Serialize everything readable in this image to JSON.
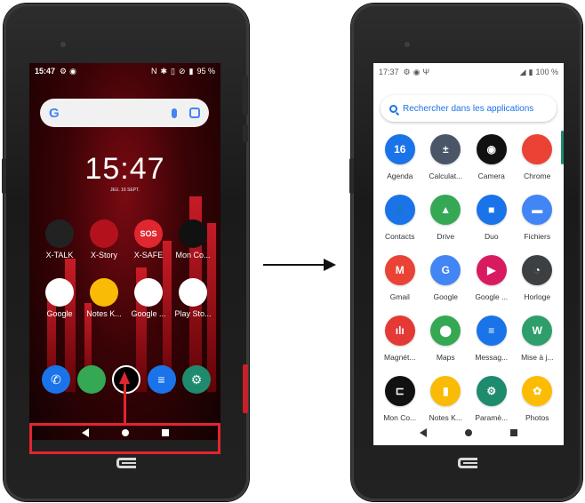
{
  "left_phone": {
    "status": {
      "time": "15:47",
      "battery": "95 %"
    },
    "clock": "15:47",
    "date": "JEU. 16 SEPT.",
    "search_logo": "G",
    "home_apps": [
      {
        "label": "X-TALK",
        "icon": "x-talk-icon",
        "color": "#222222",
        "text": ""
      },
      {
        "label": "X-Story",
        "icon": "x-story-icon",
        "color": "#b3121c",
        "text": ""
      },
      {
        "label": "X-SAFE",
        "icon": "sos-icon",
        "color": "#e0262f",
        "text": "SOS"
      },
      {
        "label": "Mon Co...",
        "icon": "crosscall-icon",
        "color": "#111111",
        "text": ""
      },
      {
        "label": "Google",
        "icon": "google-folder-icon",
        "color": "#ffffff",
        "text": ""
      },
      {
        "label": "Notes K...",
        "icon": "keep-notes-icon",
        "color": "#f9bb06",
        "text": ""
      },
      {
        "label": "Google ...",
        "icon": "play-movies-icon",
        "color": "#ffffff",
        "text": ""
      },
      {
        "label": "Play Sto...",
        "icon": "play-store-icon",
        "color": "#ffffff",
        "text": ""
      }
    ],
    "dock": [
      {
        "icon": "phone-icon",
        "color": "#1a73e8",
        "glyph": "✆"
      },
      {
        "icon": "chrome-icon",
        "color": "#34a853",
        "glyph": ""
      },
      {
        "icon": "swipe-up-icon",
        "color": "#000000",
        "glyph": ""
      },
      {
        "icon": "messages-icon",
        "color": "#1a73e8",
        "glyph": "≡"
      },
      {
        "icon": "settings-icon",
        "color": "#1e8a6e",
        "glyph": "⚙"
      }
    ]
  },
  "right_phone": {
    "status": {
      "time": "17:37",
      "battery": "100 %"
    },
    "search_placeholder": "Rechercher dans les applications",
    "apps": [
      {
        "label": "Agenda",
        "icon": "calendar-icon",
        "color": "#1a73e8",
        "text": "16"
      },
      {
        "label": "Calculat...",
        "icon": "calculator-icon",
        "color": "#4a5568",
        "text": "±"
      },
      {
        "label": "Camera",
        "icon": "camera-icon",
        "color": "#111111",
        "text": "◉"
      },
      {
        "label": "Chrome",
        "icon": "chrome-icon",
        "color": "#ea4335",
        "text": ""
      },
      {
        "label": "Contacts",
        "icon": "contacts-icon",
        "color": "#1a73e8",
        "text": "👤"
      },
      {
        "label": "Drive",
        "icon": "drive-icon",
        "color": "#34a853",
        "text": "▲"
      },
      {
        "label": "Duo",
        "icon": "duo-icon",
        "color": "#1a73e8",
        "text": "■"
      },
      {
        "label": "Fichiers",
        "icon": "files-icon",
        "color": "#4285f4",
        "text": "▬"
      },
      {
        "label": "Gmail",
        "icon": "gmail-icon",
        "color": "#ea4335",
        "text": "M"
      },
      {
        "label": "Google",
        "icon": "google-icon",
        "color": "#4285f4",
        "text": "G"
      },
      {
        "label": "Google ...",
        "icon": "play-movies-icon",
        "color": "#d81b60",
        "text": "▶"
      },
      {
        "label": "Horloge",
        "icon": "clock-icon",
        "color": "#3c4043",
        "text": "◔"
      },
      {
        "label": "Magnét...",
        "icon": "recorder-icon",
        "color": "#e53935",
        "text": "ılı"
      },
      {
        "label": "Maps",
        "icon": "maps-icon",
        "color": "#34a853",
        "text": "⬤"
      },
      {
        "label": "Messag...",
        "icon": "messages-icon",
        "color": "#1a73e8",
        "text": "≡"
      },
      {
        "label": "Mise à j...",
        "icon": "update-icon",
        "color": "#2e9e6a",
        "text": "W"
      },
      {
        "label": "Mon Co...",
        "icon": "crosscall-icon",
        "color": "#111111",
        "text": "⊏"
      },
      {
        "label": "Notes K...",
        "icon": "keep-notes-icon",
        "color": "#f9bb06",
        "text": "▮"
      },
      {
        "label": "Paramè...",
        "icon": "settings-icon",
        "color": "#1e8a6e",
        "text": "⚙"
      },
      {
        "label": "Photos",
        "icon": "photos-icon",
        "color": "#fbbc05",
        "text": "✿"
      }
    ]
  }
}
